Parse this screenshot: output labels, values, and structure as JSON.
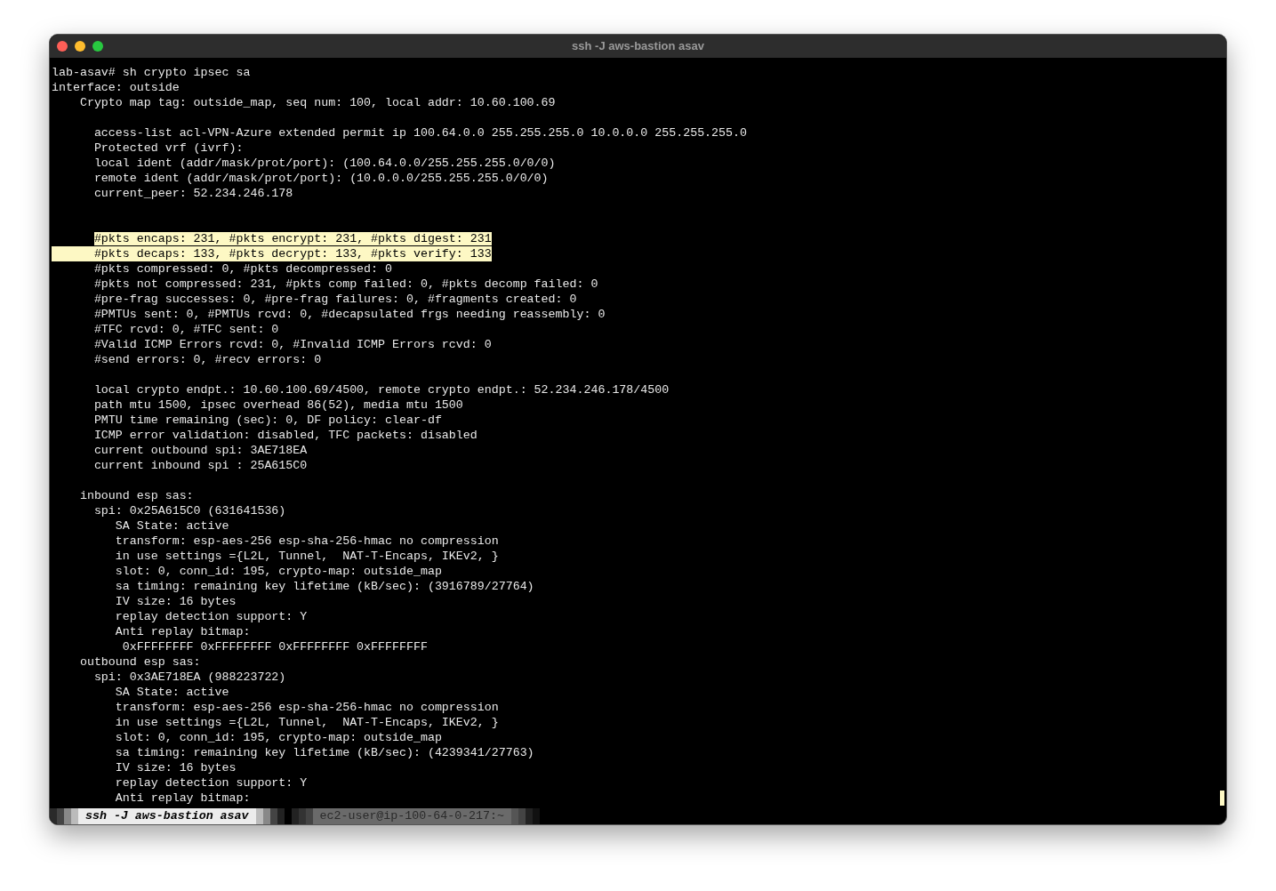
{
  "window": {
    "title": "ssh -J aws-bastion asav"
  },
  "terminal": {
    "lines": [
      {
        "kind": "text",
        "text": "lab-asav# sh crypto ipsec sa",
        "selected": false
      },
      {
        "kind": "text",
        "text": "interface: outside",
        "selected": false
      },
      {
        "kind": "text",
        "text": "    Crypto map tag: outside_map, seq num: 100, local addr: 10.60.100.69",
        "selected": false
      },
      {
        "kind": "blank"
      },
      {
        "kind": "text",
        "text": "      access-list acl-VPN-Azure extended permit ip 100.64.0.0 255.255.255.0 10.0.0.0 255.255.255.0",
        "selected": false
      },
      {
        "kind": "text",
        "text": "      Protected vrf (ivrf):",
        "selected": false
      },
      {
        "kind": "text",
        "text": "      local ident (addr/mask/prot/port): (100.64.0.0/255.255.255.0/0/0)",
        "selected": false
      },
      {
        "kind": "text",
        "text": "      remote ident (addr/mask/prot/port): (10.0.0.0/255.255.255.0/0/0)",
        "selected": false
      },
      {
        "kind": "text",
        "text": "      current_peer: 52.234.246.178",
        "selected": false
      },
      {
        "kind": "blank"
      },
      {
        "kind": "blank"
      },
      {
        "kind": "text",
        "text": "      #pkts encaps: 231, #pkts encrypt: 231, #pkts digest: 231",
        "selected": true
      },
      {
        "kind": "margin_selected",
        "text": "      #pkts decaps: 133, #pkts decrypt: 133, #pkts verify: 133",
        "selected": true
      },
      {
        "kind": "text",
        "text": "      #pkts compressed: 0, #pkts decompressed: 0",
        "selected": false
      },
      {
        "kind": "text",
        "text": "      #pkts not compressed: 231, #pkts comp failed: 0, #pkts decomp failed: 0",
        "selected": false
      },
      {
        "kind": "text",
        "text": "      #pre-frag successes: 0, #pre-frag failures: 0, #fragments created: 0",
        "selected": false
      },
      {
        "kind": "text",
        "text": "      #PMTUs sent: 0, #PMTUs rcvd: 0, #decapsulated frgs needing reassembly: 0",
        "selected": false
      },
      {
        "kind": "text",
        "text": "      #TFC rcvd: 0, #TFC sent: 0",
        "selected": false
      },
      {
        "kind": "text",
        "text": "      #Valid ICMP Errors rcvd: 0, #Invalid ICMP Errors rcvd: 0",
        "selected": false
      },
      {
        "kind": "text",
        "text": "      #send errors: 0, #recv errors: 0",
        "selected": false
      },
      {
        "kind": "blank"
      },
      {
        "kind": "text",
        "text": "      local crypto endpt.: 10.60.100.69/4500, remote crypto endpt.: 52.234.246.178/4500",
        "selected": false
      },
      {
        "kind": "text",
        "text": "      path mtu 1500, ipsec overhead 86(52), media mtu 1500",
        "selected": false
      },
      {
        "kind": "text",
        "text": "      PMTU time remaining (sec): 0, DF policy: clear-df",
        "selected": false
      },
      {
        "kind": "text",
        "text": "      ICMP error validation: disabled, TFC packets: disabled",
        "selected": false
      },
      {
        "kind": "text",
        "text": "      current outbound spi: 3AE718EA",
        "selected": false
      },
      {
        "kind": "text",
        "text": "      current inbound spi : 25A615C0",
        "selected": false
      },
      {
        "kind": "blank"
      },
      {
        "kind": "text",
        "text": "    inbound esp sas:",
        "selected": false
      },
      {
        "kind": "text",
        "text": "      spi: 0x25A615C0 (631641536)",
        "selected": false
      },
      {
        "kind": "text",
        "text": "         SA State: active",
        "selected": false
      },
      {
        "kind": "text",
        "text": "         transform: esp-aes-256 esp-sha-256-hmac no compression",
        "selected": false
      },
      {
        "kind": "text",
        "text": "         in use settings ={L2L, Tunnel,  NAT-T-Encaps, IKEv2, }",
        "selected": false
      },
      {
        "kind": "text",
        "text": "         slot: 0, conn_id: 195, crypto-map: outside_map",
        "selected": false
      },
      {
        "kind": "text",
        "text": "         sa timing: remaining key lifetime (kB/sec): (3916789/27764)",
        "selected": false
      },
      {
        "kind": "text",
        "text": "         IV size: 16 bytes",
        "selected": false
      },
      {
        "kind": "text",
        "text": "         replay detection support: Y",
        "selected": false
      },
      {
        "kind": "text",
        "text": "         Anti replay bitmap:",
        "selected": false
      },
      {
        "kind": "text",
        "text": "          0xFFFFFFFF 0xFFFFFFFF 0xFFFFFFFF 0xFFFFFFFF",
        "selected": false
      },
      {
        "kind": "text",
        "text": "    outbound esp sas:",
        "selected": false
      },
      {
        "kind": "text",
        "text": "      spi: 0x3AE718EA (988223722)",
        "selected": false
      },
      {
        "kind": "text",
        "text": "         SA State: active",
        "selected": false
      },
      {
        "kind": "text",
        "text": "         transform: esp-aes-256 esp-sha-256-hmac no compression",
        "selected": false
      },
      {
        "kind": "text",
        "text": "         in use settings ={L2L, Tunnel,  NAT-T-Encaps, IKEv2, }",
        "selected": false
      },
      {
        "kind": "text",
        "text": "         slot: 0, conn_id: 195, crypto-map: outside_map",
        "selected": false
      },
      {
        "kind": "text",
        "text": "         sa timing: remaining key lifetime (kB/sec): (4239341/27763)",
        "selected": false
      },
      {
        "kind": "text",
        "text": "         IV size: 16 bytes",
        "selected": false
      },
      {
        "kind": "text",
        "text": "         replay detection support: Y",
        "selected": false
      },
      {
        "kind": "text",
        "text": "         Anti replay bitmap:",
        "selected": false
      }
    ]
  },
  "status_bar": {
    "tabs": [
      {
        "label": "ssh -J aws-bastion asav",
        "selected": true
      },
      {
        "label": "ec2-user@ip-100-64-0-217:~",
        "selected": false
      }
    ]
  }
}
